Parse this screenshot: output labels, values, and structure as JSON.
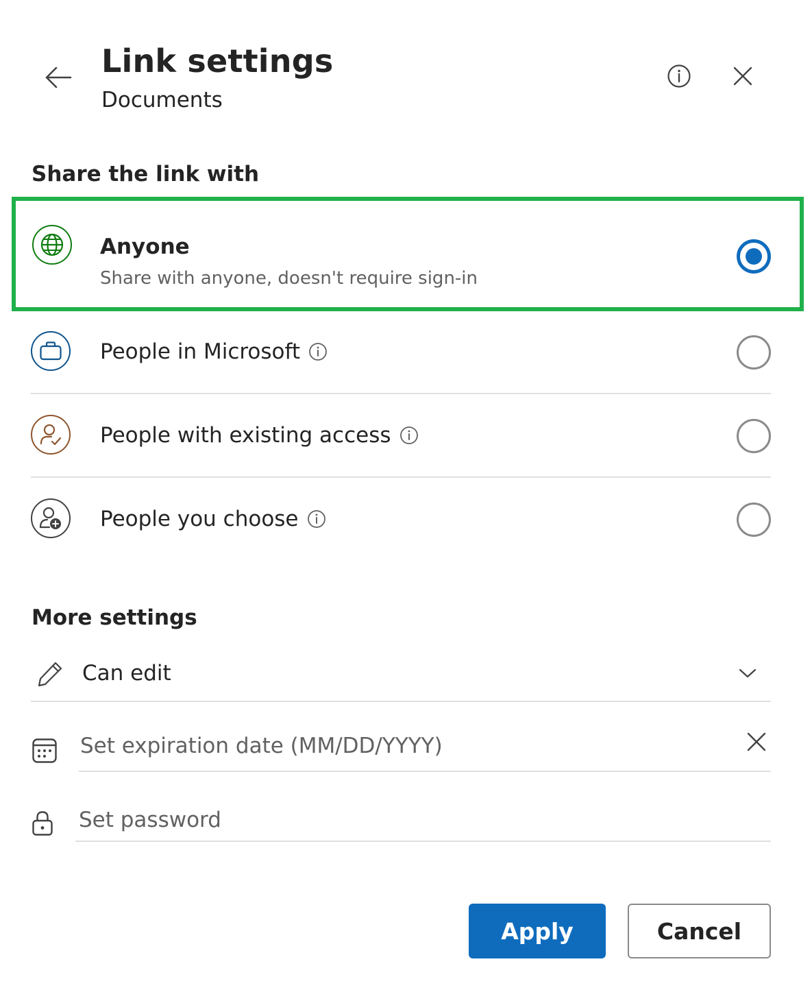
{
  "header": {
    "title": "Link settings",
    "subtitle": "Documents"
  },
  "share_section": {
    "title": "Share the link with",
    "selected": "anyone",
    "options": [
      {
        "id": "anyone",
        "label": "Anyone",
        "description": "Share with anyone, doesn't require sign-in",
        "icon": "globe-icon",
        "color": "#107c10",
        "selected": true
      },
      {
        "id": "org",
        "label": "People in Microsoft",
        "icon": "briefcase-icon",
        "color": "#0f548c",
        "selected": false
      },
      {
        "id": "existing",
        "label": "People with existing access",
        "icon": "person-check-icon",
        "color": "#8e562e",
        "selected": false
      },
      {
        "id": "specific",
        "label": "People you choose",
        "icon": "person-add-icon",
        "color": "#424242",
        "selected": false
      }
    ]
  },
  "more_settings": {
    "title": "More settings",
    "permission": {
      "value": "Can edit",
      "icon": "pencil-icon"
    },
    "expiration": {
      "placeholder": "Set expiration date (MM/DD/YYYY)",
      "icon": "calendar-icon"
    },
    "password": {
      "placeholder": "Set password",
      "icon": "lock-icon"
    }
  },
  "footer": {
    "apply_label": "Apply",
    "cancel_label": "Cancel"
  },
  "colors": {
    "accent": "#0f6cbd",
    "highlight": "#1fb14a"
  }
}
